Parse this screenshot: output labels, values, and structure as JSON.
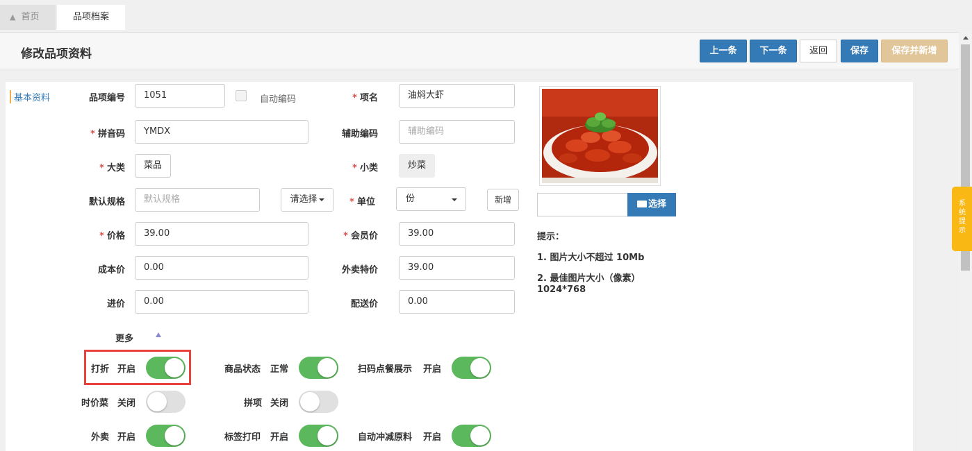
{
  "tabs": {
    "home": "首页",
    "current": "品项档案"
  },
  "page_title": "修改品项资料",
  "toolbar": {
    "prev": "上一条",
    "next": "下一条",
    "back": "返回",
    "save": "保存",
    "save_new": "保存并新增"
  },
  "side_label": "基本资料",
  "required_mark": "*",
  "form": {
    "code": {
      "label": "品项编号",
      "value": "1051"
    },
    "auto_code": {
      "label": "自动编码",
      "checked": false
    },
    "name": {
      "label": "项名",
      "value": "油焖大虾"
    },
    "pinyin": {
      "label": "拼音码",
      "value": "YMDX"
    },
    "aux_code": {
      "label": "辅助编码",
      "placeholder": "辅助编码"
    },
    "category": {
      "label": "大类",
      "value": "菜品"
    },
    "subcategory": {
      "label": "小类",
      "value": "炒菜"
    },
    "default_spec": {
      "label": "默认规格",
      "placeholder": "默认规格",
      "select_label": "请选择"
    },
    "unit": {
      "label": "单位",
      "value": "份",
      "add_label": "新增"
    },
    "price": {
      "label": "价格",
      "value": "39.00"
    },
    "member_price": {
      "label": "会员价",
      "value": "39.00"
    },
    "cost_price": {
      "label": "成本价",
      "value": "0.00"
    },
    "takeout_price": {
      "label": "外卖特价",
      "value": "39.00"
    },
    "purchase_price": {
      "label": "进价",
      "value": "0.00"
    },
    "delivery_price": {
      "label": "配送价",
      "value": "0.00"
    }
  },
  "more_label": "更多",
  "toggles": {
    "discount": {
      "label": "打折",
      "state": "开启",
      "on": true
    },
    "product_status": {
      "label": "商品状态",
      "state": "正常",
      "on": true
    },
    "scan_order_display": {
      "label": "扫码点餐展示",
      "state": "开启",
      "on": true
    },
    "market_price": {
      "label": "时价菜",
      "state": "关闭",
      "on": false
    },
    "combo_item": {
      "label": "拼项",
      "state": "关闭",
      "on": false
    },
    "takeout": {
      "label": "外卖",
      "state": "开启",
      "on": true
    },
    "label_print": {
      "label": "标签打印",
      "state": "开启",
      "on": true
    },
    "auto_deduct_material": {
      "label": "自动冲减原料",
      "state": "开启",
      "on": true
    }
  },
  "image": {
    "select_label": "选择"
  },
  "hints": {
    "title": "提示：",
    "line1": "1. 图片大小不超过 10Mb",
    "line2": "2. 最佳图片大小（像素）",
    "line3": "1024*768"
  },
  "system_tip": "系统提示",
  "colors": {
    "primary": "#337ab7",
    "toggle_on": "#5cb85c",
    "highlight": "#e8403a",
    "save_new": "#e1c699",
    "tip_tab": "#f9b814"
  }
}
